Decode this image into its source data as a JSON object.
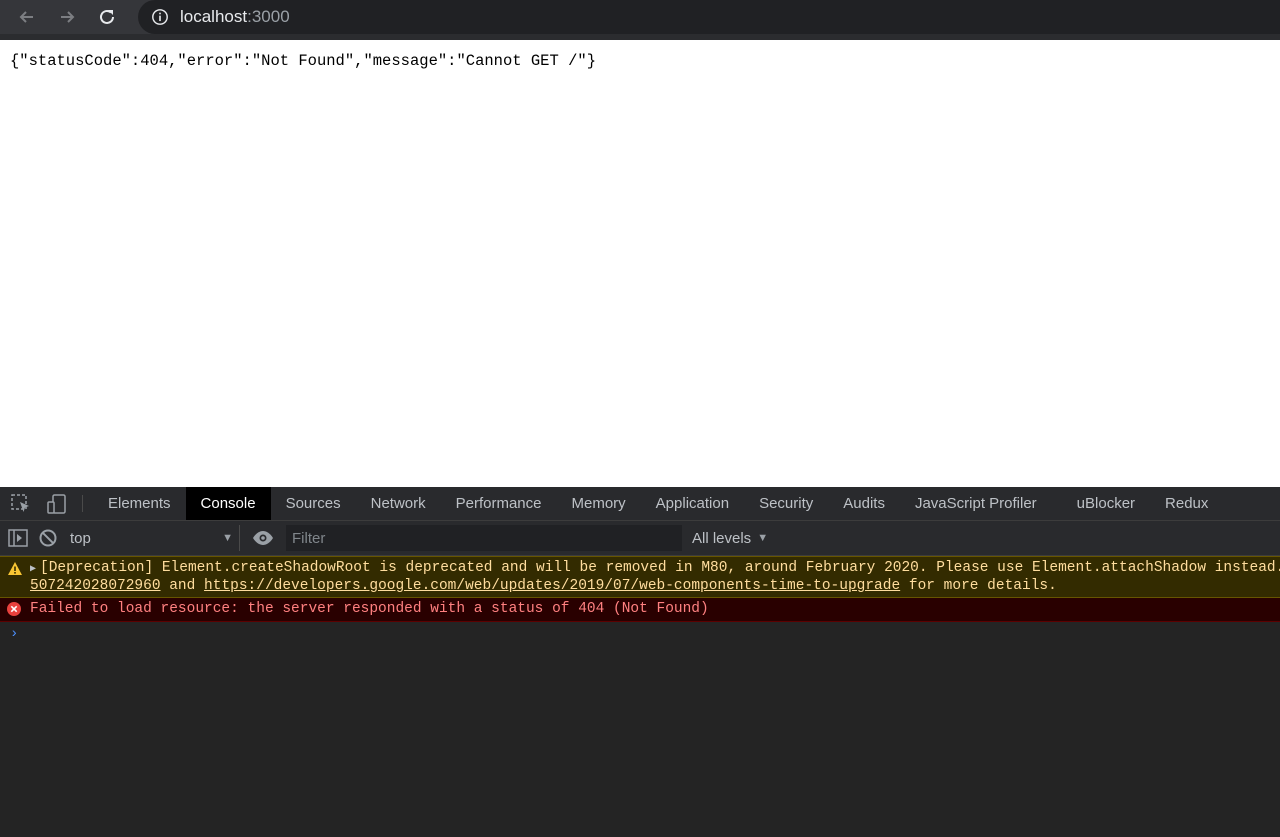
{
  "browser": {
    "url_host": "localhost",
    "url_port": ":3000"
  },
  "page": {
    "json_text": "{\"statusCode\":404,\"error\":\"Not Found\",\"message\":\"Cannot GET /\"}"
  },
  "devtools": {
    "tabs": [
      "Elements",
      "Console",
      "Sources",
      "Network",
      "Performance",
      "Memory",
      "Application",
      "Security",
      "Audits",
      "JavaScript Profiler",
      "uBlocker",
      "Redux"
    ],
    "active_tab": "Console",
    "context": "top",
    "filter_placeholder": "Filter",
    "levels_label": "All levels",
    "warning": {
      "line1": "[Deprecation] Element.createShadowRoot is deprecated and will be removed in M80, around February 2020. Please use Element.attachShadow instead. See",
      "link1": "507242028072960",
      "and": " and ",
      "link2": "https://developers.google.com/web/updates/2019/07/web-components-time-to-upgrade",
      "suffix": " for more details."
    },
    "error": {
      "text": "Failed to load resource: the server responded with a status of 404 (Not Found)"
    },
    "prompt_symbol": "›"
  },
  "colors": {
    "warning_text": "#ffdd9e",
    "error_text": "#ff8080",
    "prompt": "#4d90fe"
  }
}
